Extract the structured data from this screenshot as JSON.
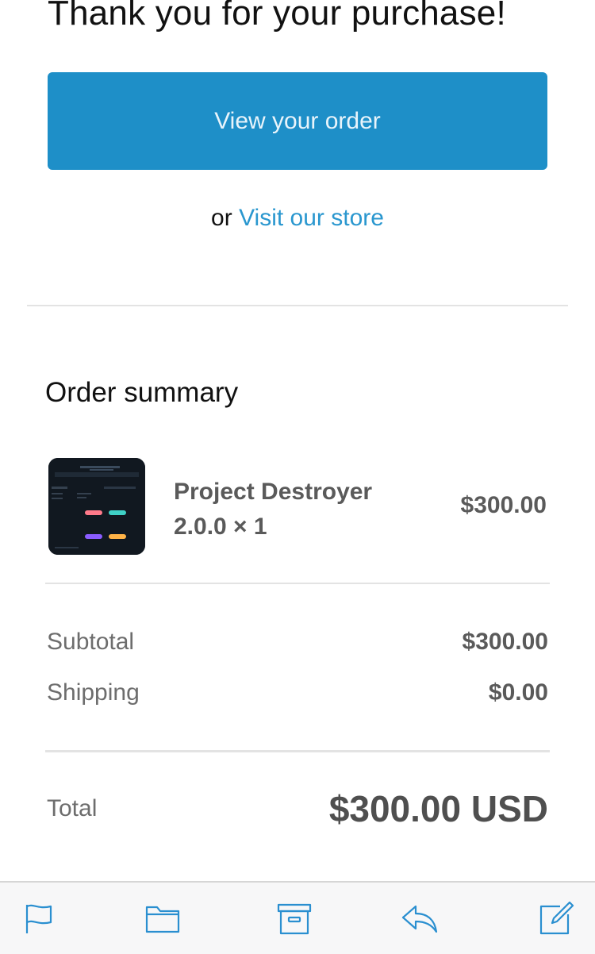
{
  "header": {
    "title": "Thank you for your purchase!"
  },
  "actions": {
    "view_order_label": "View your order",
    "or_text": "or",
    "visit_store_label": "Visit our store"
  },
  "summary": {
    "title": "Order summary",
    "item": {
      "name_line1": "Project Destroyer",
      "name_line2": "2.0.0 × 1",
      "price": "$300.00"
    },
    "subtotal_label": "Subtotal",
    "subtotal_value": "$300.00",
    "shipping_label": "Shipping",
    "shipping_value": "$0.00",
    "total_label": "Total",
    "total_value": "$300.00 USD"
  },
  "toolbar": {
    "items": [
      "flag-icon",
      "folder-icon",
      "archive-icon",
      "reply-icon",
      "compose-icon"
    ],
    "tint": "#2a8fd0"
  },
  "colors": {
    "primary_button": "#1e8fc8",
    "link": "#2a97cf"
  }
}
